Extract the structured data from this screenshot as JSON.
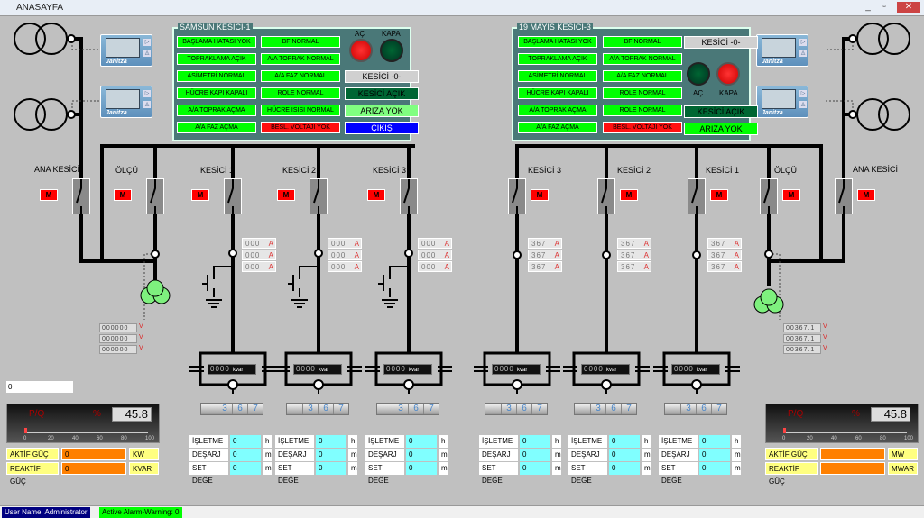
{
  "window": {
    "title": "ANASAYFA",
    "controls": [
      "_",
      "▫",
      "✕"
    ]
  },
  "panel_left": {
    "title": "SAMSUN KESİCİ-1",
    "col1": [
      "BAŞLAMA HATASI YOK",
      "TOPRAKLAMA AÇIK",
      "ASİMETRİ NORMAL",
      "HÜCRE KAPI KAPALI",
      "A/A TOPRAK AÇMA",
      "A/A FAZ AÇMA"
    ],
    "col2": [
      "BF NORMAL",
      "A/A TOPRAK NORMAL",
      "A/A FAZ NORMAL",
      "ROLE NORMAL",
      "HÜCRE ISISI NORMAL",
      "BESL. VOLTAJI YOK"
    ],
    "ac_label": "AÇ",
    "kapa_label": "KAPA",
    "kesici": "KESİCİ -0-",
    "kesici_acik": "KESİCİ AÇIK",
    "ariza": "ARIZA YOK",
    "cikis": "ÇIKIŞ"
  },
  "panel_right": {
    "title": "19 MAYIS KESİCİ-3",
    "col1": [
      "BAŞLAMA HATASI YOK",
      "TOPRAKLAMA AÇIK",
      "ASİMETRİ NORMAL",
      "HÜCRE KAPI KAPALI",
      "A/A TOPRAK AÇMA",
      "A/A FAZ AÇMA"
    ],
    "col2": [
      "BF NORMAL",
      "A/A TOPRAK NORMAL",
      "A/A FAZ NORMAL",
      "ROLE NORMAL",
      "ROLE NORMAL",
      "BESL. VOLTAJI YOK"
    ],
    "ac_label": "AÇ",
    "kapa_label": "KAPA",
    "kesici": "KESİCİ -0-",
    "kesici_acik": "KESİCİ AÇIK",
    "ariza": "ARIZA YOK"
  },
  "meter_logo": "Janitza",
  "labels": {
    "ana_kesici": "ANA KESİCİ",
    "olcu": "ÖLÇÜ",
    "kesici1": "KESİCİ 1",
    "kesici2": "KESİCİ 2",
    "kesici3": "KESİCİ 3",
    "m": "M"
  },
  "currents_left": [
    "000",
    "000",
    "000"
  ],
  "currents_right": [
    "367",
    "367",
    "367"
  ],
  "current_unit": "A",
  "volts_left": [
    "000000",
    "000000",
    "000000"
  ],
  "volts_right": [
    "00367.1",
    "00367.1",
    "00367.1"
  ],
  "volt_unit": "V",
  "kvar": {
    "value": "0000",
    "unit": "kvar"
  },
  "counter": [
    "3",
    "6",
    "7"
  ],
  "info": {
    "isletme": "İŞLETME",
    "desarj": "DEŞARJ",
    "set": "SET DEĞE",
    "values": [
      "0",
      "0",
      "0"
    ],
    "units": [
      "h",
      "m",
      "m"
    ]
  },
  "input_value": "0",
  "meter_left": {
    "label": "P/Q",
    "pct": "%",
    "value": "45.8",
    "ticks": [
      "0",
      "20",
      "40",
      "60",
      "80",
      "100"
    ],
    "aktif": "AKTİF GÜÇ",
    "reaktif": "REAKTİF GÜÇ",
    "aktif_val": "0",
    "reaktif_val": "0",
    "aktif_unit": "KW",
    "reaktif_unit": "KVAR"
  },
  "meter_right": {
    "label": "P/Q",
    "pct": "%",
    "value": "45.8",
    "ticks": [
      "0",
      "20",
      "40",
      "60",
      "80",
      "100"
    ],
    "aktif": "AKTİF GÜÇ",
    "reaktif": "REAKTİF GÜÇ",
    "aktif_val": "",
    "reaktif_val": "",
    "aktif_unit": "MW",
    "reaktif_unit": "MWAR"
  },
  "status": {
    "user": "User Name: Administrator",
    "alarm": "Active Alarm-Warning: 0"
  },
  "colors": {
    "ok": "#00ff00",
    "fault": "#ff1010",
    "panel": "#4a7878",
    "cikis": "#0000ff"
  }
}
